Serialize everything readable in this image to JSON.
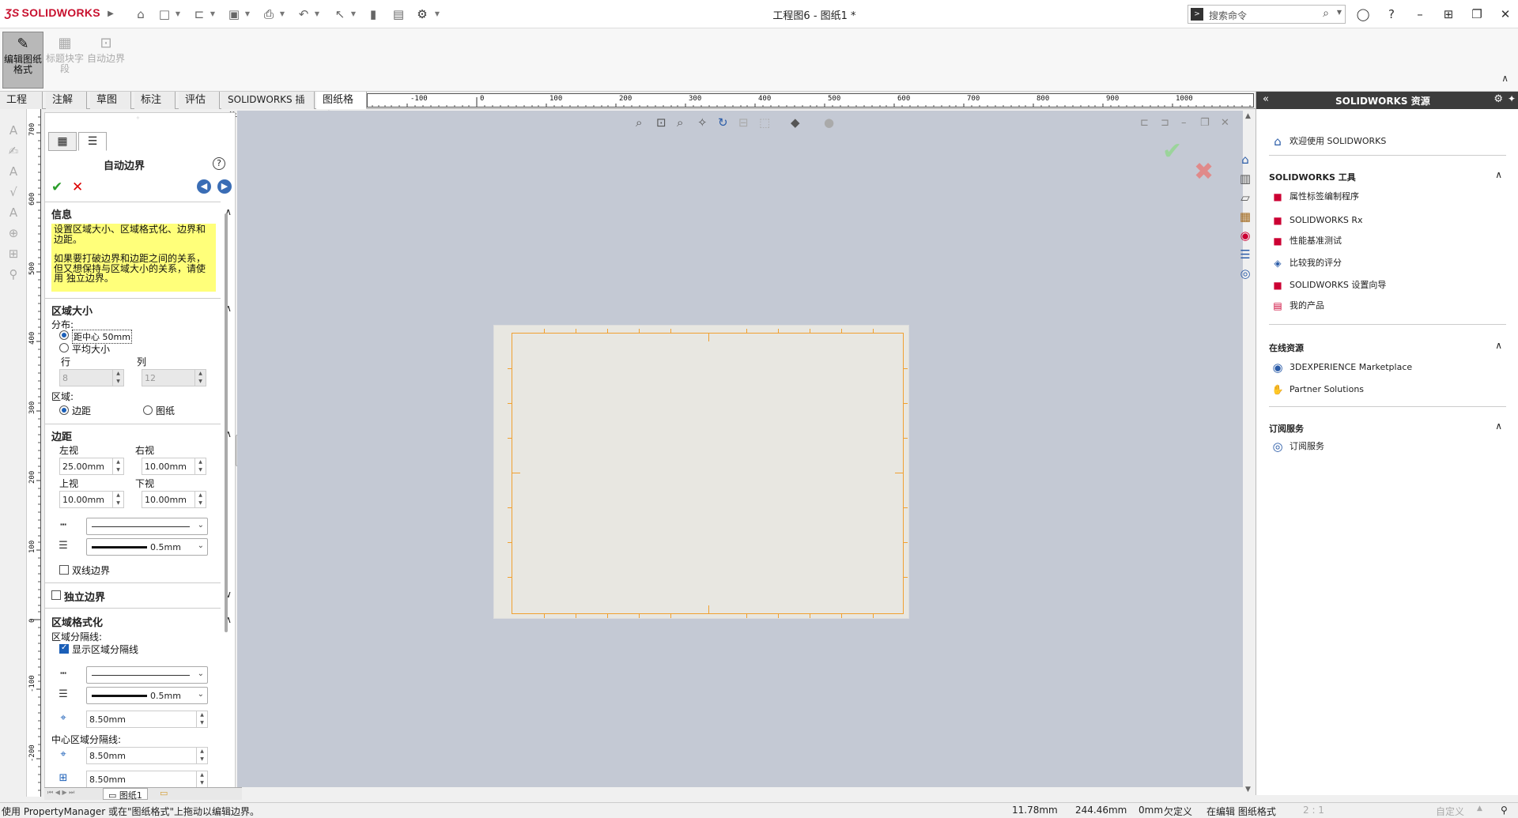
{
  "app": {
    "logo": "SOLIDWORKS",
    "title": "工程图6 - 图纸1 *"
  },
  "search": {
    "placeholder": "搜索命令"
  },
  "command_manager": {
    "buttons": [
      {
        "label": "编辑图纸格式",
        "state": "active"
      },
      {
        "label": "标题块字段",
        "state": "disabled"
      },
      {
        "label": "自动边界",
        "state": "disabled"
      }
    ]
  },
  "tabs": [
    "工程图",
    "注解",
    "草图",
    "标注",
    "评估",
    "SOLIDWORKS 插件",
    "图纸格式"
  ],
  "ruler_top": [
    "-100",
    "0",
    "100",
    "200",
    "300",
    "400",
    "500",
    "600",
    "700",
    "800",
    "900",
    "1000"
  ],
  "ruler_left": [
    "700",
    "600",
    "500",
    "400",
    "300",
    "200",
    "100",
    "0",
    "-100",
    "-200"
  ],
  "pm": {
    "title": "自动边界",
    "info": {
      "header": "信息",
      "text1": "设置区域大小、区域格式化、边界和边距。",
      "text2": "如果要打破边界和边距之间的关系，但又想保持与区域大小的关系，请使用 独立边界。"
    },
    "zone_size": {
      "header": "区域大小",
      "dist_label": "分布:",
      "opt1": "距中心 50mm",
      "opt2": "平均大小",
      "rows_label": "行",
      "cols_label": "列",
      "rows": "8",
      "cols": "12",
      "area_label": "区域:",
      "area_opt1": "边距",
      "area_opt2": "图纸"
    },
    "margins": {
      "header": "边距",
      "left_label": "左视",
      "right_label": "右视",
      "top_label": "上视",
      "bottom_label": "下视",
      "left": "25.00mm",
      "right": "10.00mm",
      "top": "10.00mm",
      "bottom": "10.00mm",
      "thickness": "0.5mm",
      "double_border": "双线边界"
    },
    "independent": {
      "header": "独立边界"
    },
    "zone_format": {
      "header": "区域格式化",
      "divider_label": "区域分隔线:",
      "show_dividers": "显示区域分隔线",
      "thickness": "0.5mm",
      "size": "8.50mm",
      "center_label": "中心区域分隔线:",
      "center_w": "8.50mm",
      "center_h": "8.50mm"
    }
  },
  "sheet_tab": "图纸1",
  "taskpane": {
    "title": "SOLIDWORKS 资源",
    "welcome": "欢迎使用 SOLIDWORKS",
    "tools_header": "SOLIDWORKS 工具",
    "tools": [
      "属性标签编制程序",
      "SOLIDWORKS Rx",
      "性能基准测试",
      "比较我的评分",
      "SOLIDWORKS 设置向导",
      "我的产品"
    ],
    "online_header": "在线资源",
    "online": [
      "3DEXPERIENCE Marketplace",
      "Partner Solutions"
    ],
    "sub_header": "订阅服务",
    "sub": [
      "订阅服务"
    ]
  },
  "status": {
    "message": "使用 PropertyManager 或在\"图纸格式\"上拖动以编辑边界。",
    "x": "11.78mm",
    "y": "244.46mm",
    "z": "0mm",
    "state": "欠定义",
    "mode": "在编辑 图纸格式",
    "scale": "2 : 1",
    "custom": "自定义"
  },
  "colors": {
    "accent": "#1b5fb8",
    "border_orange": "#f0a030",
    "canvas": "#c4c9d4",
    "info_yellow": "#ffff7a"
  }
}
